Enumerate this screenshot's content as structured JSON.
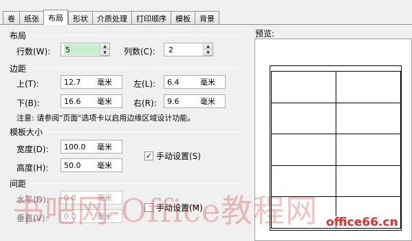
{
  "tabs": [
    "卷",
    "纸张",
    "布局",
    "形状",
    "介质处理",
    "打印顺序",
    "模板",
    "背景"
  ],
  "layout": {
    "title": "布局",
    "rows_label": "行数(W):",
    "rows_value": "5",
    "cols_label": "列数(C):",
    "cols_value": "2"
  },
  "margins": {
    "title": "边距",
    "top_label": "上(T):",
    "top_value": "12.7",
    "left_label": "左(L):",
    "left_value": "6.4",
    "bottom_label": "下(B):",
    "bottom_value": "16.6",
    "right_label": "右(R):",
    "right_value": "9.6",
    "unit": "毫米",
    "note": "注意: 请参阅\"页面\"选项卡以启用边缘区域设计功能。"
  },
  "template_size": {
    "title": "模板大小",
    "width_label": "宽度(D):",
    "width_value": "100.0",
    "height_label": "高度(H):",
    "height_value": "50.0",
    "unit": "毫米",
    "manual_label": "手动设置(S)",
    "manual_checked": true
  },
  "spacing": {
    "title": "间距",
    "horizontal_label": "水平(O):",
    "horizontal_value": "0.0",
    "vertical_label": "垂直(V):",
    "vertical_value": "0.0",
    "unit": "毫米",
    "manual_label": "手动设置(M)",
    "manual_checked": false
  },
  "preview": {
    "label": "预览:",
    "rows": 5,
    "cols": 2
  },
  "watermark": "书吧网-Office教程网",
  "brand": "office66.cn",
  "colors": {
    "selected_field": "#c6efce",
    "watermark": "#c82828",
    "brand": "#e03030"
  }
}
